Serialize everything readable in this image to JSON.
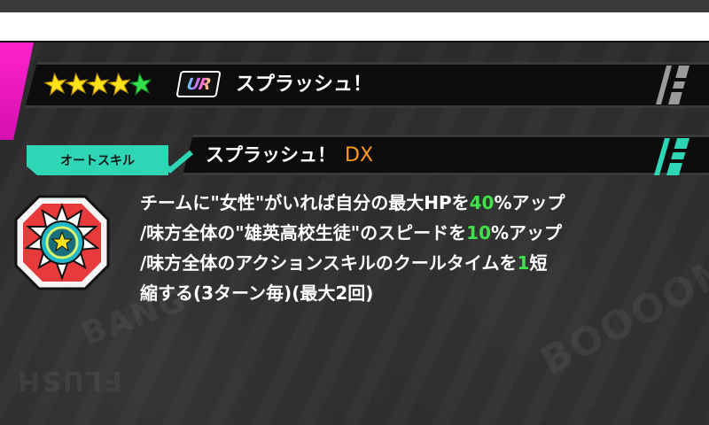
{
  "card": {
    "rarity_label": "UR",
    "star_count": 5,
    "title": "スプラッシュ！"
  },
  "skill": {
    "type_label": "オートスキル",
    "name": "スプラッシュ！",
    "grade": "DX",
    "description": {
      "line1_a": "チームに\"女性\"がいれば自分の最大HPを",
      "line1_val": "40",
      "line1_b": "%アップ",
      "line2_a": "/味方全体の\"雄英高校生徒\"のスピードを",
      "line2_val": "10",
      "line2_b": "%アップ",
      "line3_a": "/味方全体のアクションスキルのクールタイムを",
      "line3_val": "1",
      "line3_b": "短",
      "line4": "縮する(3ターン毎)(最大2回)"
    }
  },
  "background_words": [
    "BOOOOM",
    "FLUSH",
    "BANG"
  ],
  "colors": {
    "accent_magenta": "#ff22cc",
    "accent_teal": "#2fd6b6",
    "star_yellow": "#ffe21a",
    "star_green": "#35e04a",
    "highlight_green": "#3fe04a",
    "grade_orange": "#ff9b1a"
  },
  "icons": {
    "stars": "star-icon",
    "skill": "skill-burst-icon",
    "tag_check": "check-icon"
  }
}
